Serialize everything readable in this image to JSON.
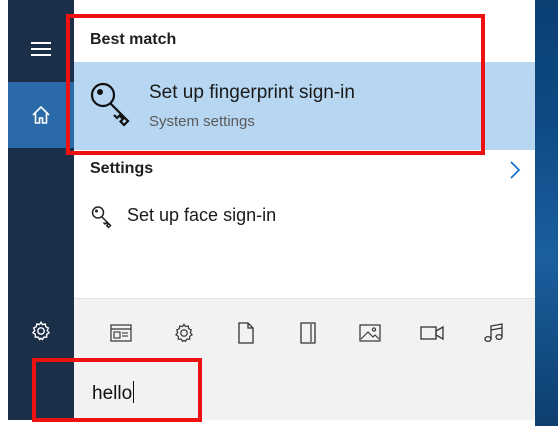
{
  "best_match": {
    "section_title": "Best match",
    "title": "Set up fingerprint sign-in",
    "subtitle": "System settings",
    "icon": "key-icon"
  },
  "settings": {
    "section_title": "Settings",
    "items": [
      {
        "label": "Set up face sign-in",
        "icon": "key-icon"
      }
    ]
  },
  "rail": {
    "items": [
      {
        "name": "hamburger-menu",
        "icon": "hamburger-icon"
      },
      {
        "name": "home",
        "icon": "home-icon",
        "selected": true
      },
      {
        "name": "settings",
        "icon": "gear-icon"
      }
    ]
  },
  "filters": [
    {
      "name": "apps",
      "icon": "apps-icon"
    },
    {
      "name": "settings",
      "icon": "gear-icon"
    },
    {
      "name": "documents",
      "icon": "document-icon"
    },
    {
      "name": "folders",
      "icon": "folder-icon"
    },
    {
      "name": "photos",
      "icon": "photo-icon"
    },
    {
      "name": "videos",
      "icon": "video-icon"
    },
    {
      "name": "music",
      "icon": "music-icon"
    }
  ],
  "search": {
    "value": "hello"
  },
  "colors": {
    "rail_background": "#1c2f49",
    "rail_selected": "#2a6aa8",
    "highlight": "#b7d6f1",
    "annotation": "#ee1111",
    "accent": "#0078d7"
  }
}
